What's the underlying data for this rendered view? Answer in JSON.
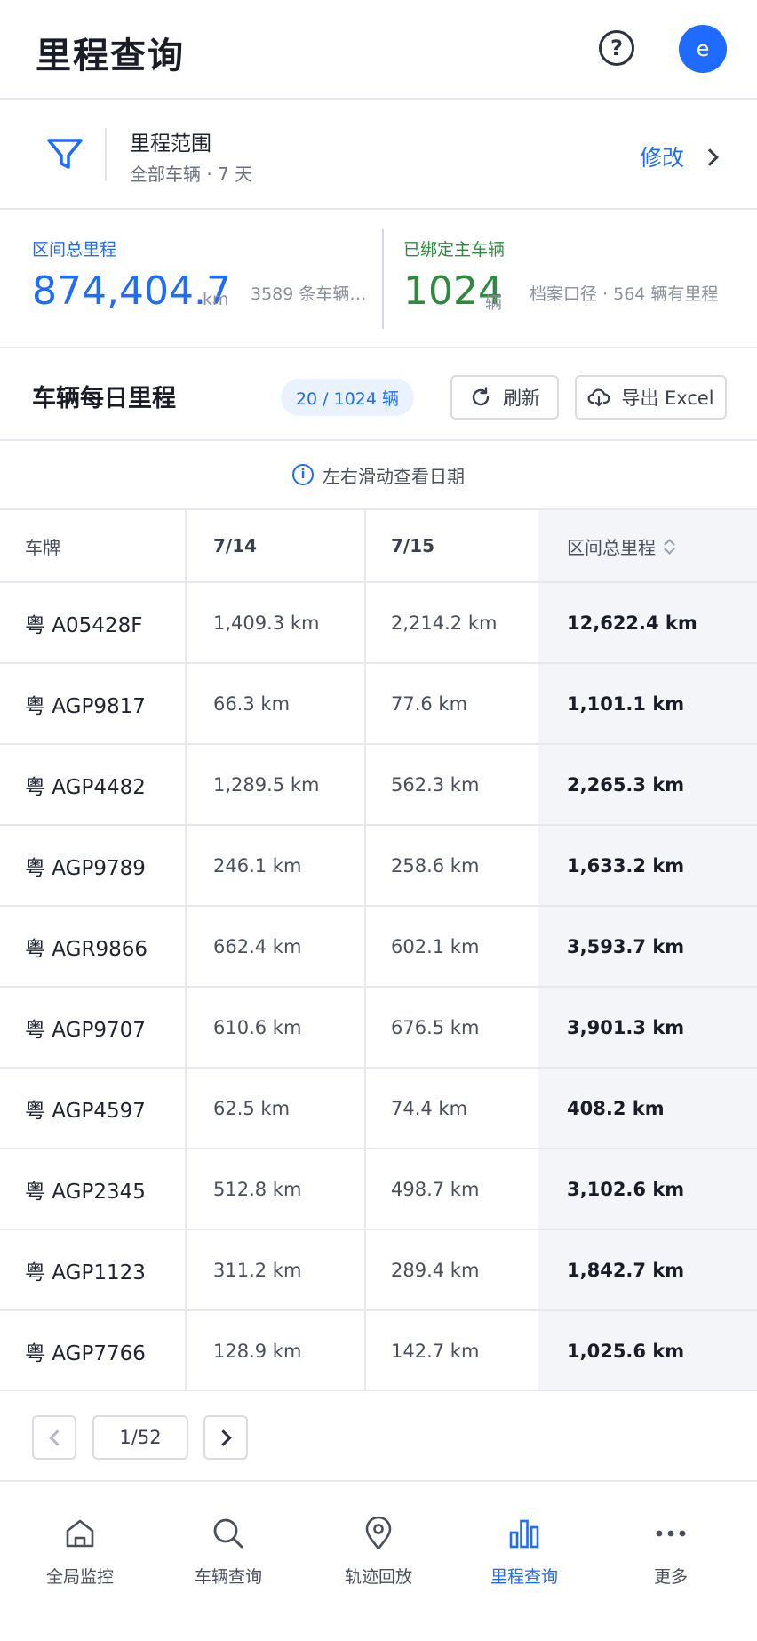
{
  "header": {
    "title": "里程查询",
    "help_icon": "?",
    "avatar_initial": "e"
  },
  "filter": {
    "title": "里程范围",
    "subtitle": "全部车辆 · 7 天",
    "edit_label": "修改"
  },
  "stats": {
    "left": {
      "label": "区间总里程",
      "value": "874,404.7",
      "unit": "km",
      "note": "3589 条车辆…",
      "color": "#1f6bff"
    },
    "right": {
      "label": "已绑定主车辆",
      "value": "1024",
      "unit": "辆",
      "note": "档案口径 · 564 辆有里程",
      "color": "#2e8b3e"
    }
  },
  "section": {
    "title": "车辆每日里程",
    "count_pill": "20 / 1024 辆",
    "refresh_label": "刷新",
    "export_label": "导出 Excel"
  },
  "hint": {
    "text": "左右滑动查看日期"
  },
  "table": {
    "columns": [
      "车牌",
      "7/14",
      "7/15",
      "区间总里程"
    ],
    "rows": [
      [
        "粤 A05428F",
        "1,409.3 km",
        "2,214.2 km",
        "12,622.4 km"
      ],
      [
        "粤 AGP9817",
        "66.3 km",
        "77.6 km",
        "1,101.1 km"
      ],
      [
        "粤 AGP4482",
        "1,289.5 km",
        "562.3 km",
        "2,265.3 km"
      ],
      [
        "粤 AGP9789",
        "246.1 km",
        "258.6 km",
        "1,633.2 km"
      ],
      [
        "粤 AGR9866",
        "662.4 km",
        "602.1 km",
        "3,593.7 km"
      ],
      [
        "粤 AGP9707",
        "610.6 km",
        "676.5 km",
        "3,901.3 km"
      ],
      [
        "粤 AGP4597",
        "62.5 km",
        "74.4 km",
        "408.2 km"
      ],
      [
        "粤 AGP2345",
        "512.8 km",
        "498.7 km",
        "3,102.6 km"
      ],
      [
        "粤 AGP1123",
        "311.2 km",
        "289.4 km",
        "1,842.7 km"
      ],
      [
        "粤 AGP7766",
        "128.9 km",
        "142.7 km",
        "1,025.6 km"
      ]
    ]
  },
  "pagination": {
    "page_label": "1/52"
  },
  "nav": {
    "items": [
      {
        "label": "全局监控",
        "icon": "home-icon"
      },
      {
        "label": "车辆查询",
        "icon": "search-icon"
      },
      {
        "label": "轨迹回放",
        "icon": "location-pin-icon"
      },
      {
        "label": "里程查询",
        "icon": "bar-chart-icon",
        "active": true
      },
      {
        "label": "更多",
        "icon": "more-dots-icon"
      }
    ],
    "active_color": "#1f6bff"
  }
}
